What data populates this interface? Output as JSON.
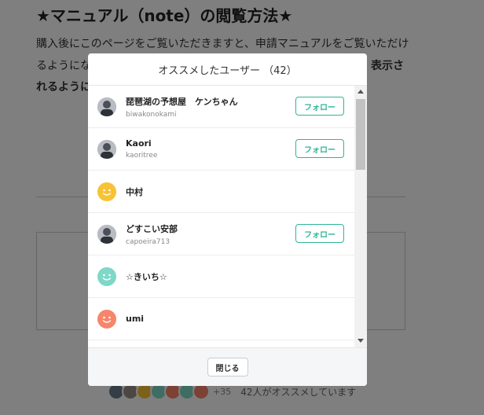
{
  "article": {
    "title": "★マニュアル（note）の閲覧方法★",
    "line1": "購入後にこのページをご覧いただきますと、申請マニュアルをご覧いただけ",
    "line2": "るようにな",
    "line2_bold": "表示さ",
    "line3": "れるように",
    "recommend_more": "+35",
    "recommend_text": "42人がオススメしています"
  },
  "modal": {
    "title": "オススメしたユーザー （42）",
    "follow_label": "フォロー",
    "close_label": "閉じる",
    "users": [
      {
        "name": "琵琶湖の予想屋　ケンちゃん",
        "id": "biwakonokami",
        "follow": true,
        "avatar": "photo"
      },
      {
        "name": "Kaori",
        "id": "kaoritree",
        "follow": true,
        "avatar": "photo"
      },
      {
        "name": "中村",
        "id": "",
        "follow": false,
        "avatar": "smile-yellow"
      },
      {
        "name": "どすこい安部",
        "id": "capoeira713",
        "follow": true,
        "avatar": "photo"
      },
      {
        "name": "☆きいち☆",
        "id": "",
        "follow": false,
        "avatar": "smile-teal"
      },
      {
        "name": "umi",
        "id": "",
        "follow": false,
        "avatar": "smile-orange"
      },
      {
        "name": "",
        "id": "",
        "follow": false,
        "avatar": "smile-orange"
      }
    ]
  },
  "colors": {
    "accent": "#2cb696",
    "smile_yellow": "#f8c234",
    "smile_teal": "#7fd8c7",
    "smile_orange": "#f7856b"
  }
}
